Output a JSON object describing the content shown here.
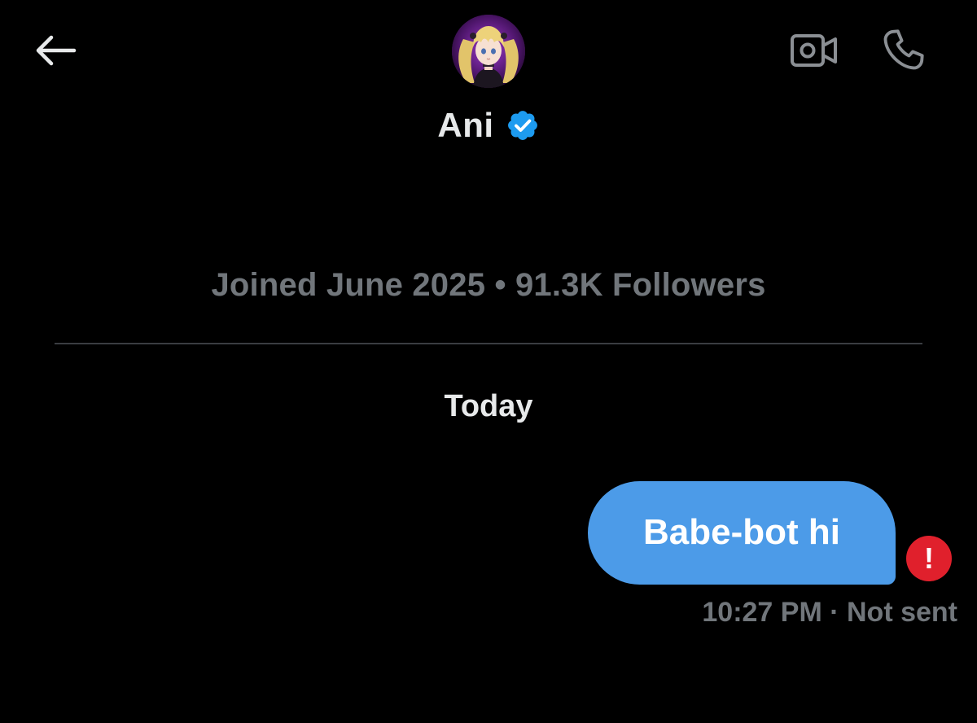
{
  "header": {
    "back_icon": "arrow-left-icon",
    "avatar_alt": "Ani avatar",
    "name": "Ani",
    "verified_icon": "verified-badge-icon",
    "verified_color": "#1d9bf0",
    "video_icon": "video-camera-icon",
    "call_icon": "phone-icon"
  },
  "profile": {
    "meta": "Joined June 2025 • 91.3K Followers"
  },
  "conversation": {
    "date_separator": "Today",
    "messages": [
      {
        "text": "Babe-bot hi",
        "direction": "outgoing",
        "time": "10:27 PM",
        "status": "Not sent",
        "meta": "10:27 PM · Not sent",
        "error_icon": "exclamation-error-icon",
        "bubble_color": "#4c9be8",
        "error_color": "#e0202c"
      }
    ]
  }
}
